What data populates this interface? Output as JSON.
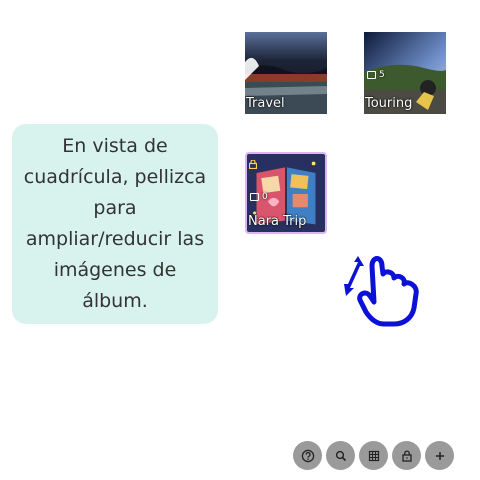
{
  "albums": [
    {
      "name": "Travel",
      "count": "",
      "locked": false
    },
    {
      "name": "Touring",
      "count": "5",
      "locked": false
    },
    {
      "name": "Nara Trip",
      "count": "0",
      "locked": true
    }
  ],
  "hint": {
    "text": "En vista de cuadrícula, pellizca para ampliar/reducir las imágenes de álbum."
  },
  "toolbar": {
    "items": [
      {
        "icon": "help-icon"
      },
      {
        "icon": "search-icon"
      },
      {
        "icon": "grid-view-icon"
      },
      {
        "icon": "lock-icon"
      },
      {
        "icon": "add-icon"
      }
    ]
  },
  "colors": {
    "hint_bg": "#d8f3ee",
    "gesture_blue": "#0b12d6",
    "toolbar_button": "#9a9a9a",
    "nara_border": "#d9b6f2"
  }
}
